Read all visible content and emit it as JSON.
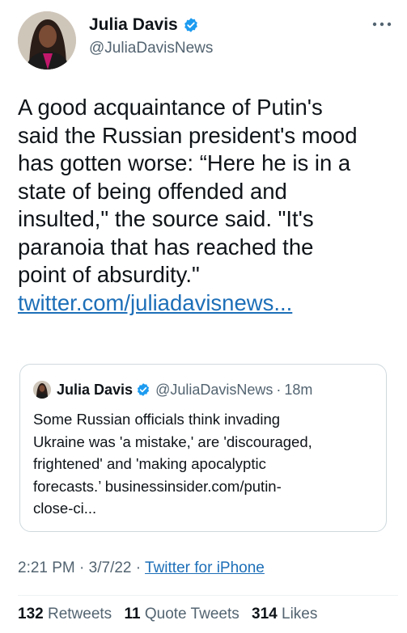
{
  "header": {
    "display_name": "Julia Davis",
    "handle": "@JuliaDavisNews",
    "verified": true,
    "more_icon": "more-horizontal-icon"
  },
  "tweet": {
    "lines": [
      "A good acquaintance of Putin's",
      "said the Russian president's mood",
      "has gotten worse: “Here he is in a",
      "state of being offended and",
      "insulted,\" the source said. \"It's",
      "paranoia that has reached the",
      "point of absurdity.\""
    ],
    "link": "twitter.com/juliadavisnews..."
  },
  "quote": {
    "display_name": "Julia Davis",
    "handle": "@JuliaDavisNews",
    "separator": "·",
    "time": "18m",
    "lines": [
      "Some Russian officials think invading",
      "Ukraine was 'a mistake,' are 'discouraged,",
      "frightened' and 'making apocalyptic",
      "forecasts.’ businessinsider.com/putin-",
      "close-ci..."
    ]
  },
  "meta": {
    "time": "2:21 PM",
    "sep1": " · ",
    "date": "3/7/22",
    "sep2": " · ",
    "source": "Twitter for iPhone"
  },
  "stats": {
    "retweets_count": "132",
    "retweets_label": "Retweets",
    "quotes_count": "11",
    "quotes_label": "Quote Tweets",
    "likes_count": "314",
    "likes_label": "Likes"
  },
  "colors": {
    "text": "#0f1419",
    "secondary": "#536471",
    "link": "#1d6fb8",
    "verified": "#1d9bf0",
    "border": "#cfd9de"
  }
}
